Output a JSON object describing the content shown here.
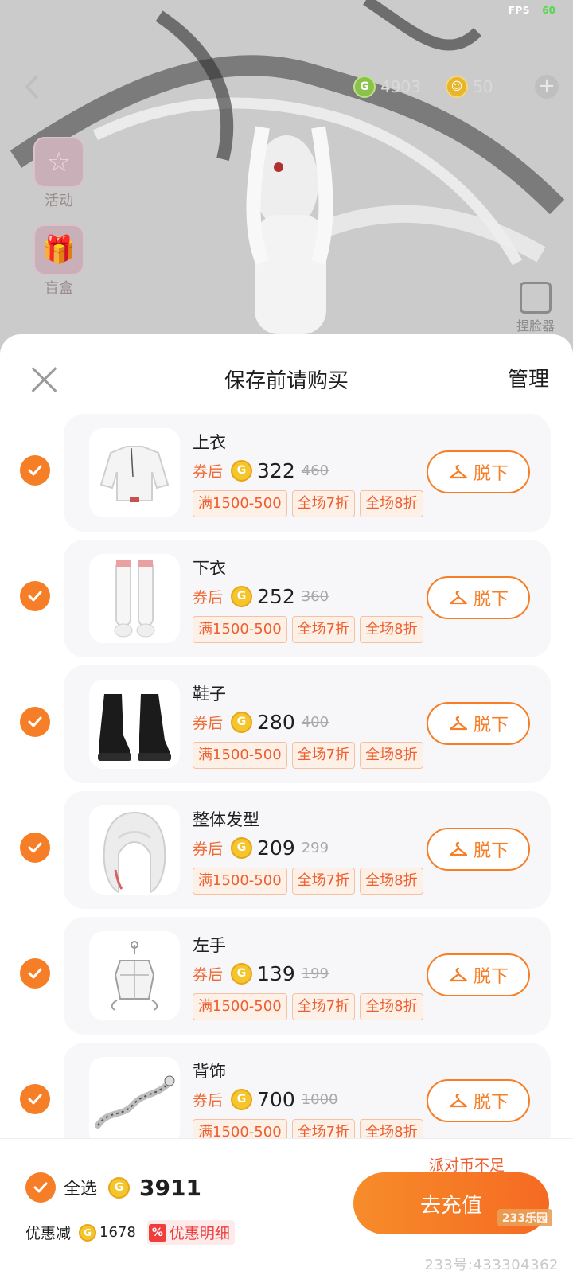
{
  "scene": {
    "fps_label": "FPS",
    "fps_value": "60",
    "coins_g": "4903",
    "coins_y": "50",
    "side_items": [
      {
        "label": "活动",
        "icon": "star-icon"
      },
      {
        "label": "盲盒",
        "icon": "gift-box-icon"
      }
    ],
    "face_edit_label": "捏脸器"
  },
  "sheet": {
    "title": "保存前请购买",
    "manage_label": "管理",
    "items": [
      {
        "name": "上衣",
        "after_label": "券后",
        "price": "322",
        "original": "460",
        "tags": [
          "满1500-500",
          "全场7折",
          "全场8折"
        ],
        "action": "脱下",
        "thumb": "shirt"
      },
      {
        "name": "下衣",
        "after_label": "券后",
        "price": "252",
        "original": "360",
        "tags": [
          "满1500-500",
          "全场7折",
          "全场8折"
        ],
        "action": "脱下",
        "thumb": "stockings"
      },
      {
        "name": "鞋子",
        "after_label": "券后",
        "price": "280",
        "original": "400",
        "tags": [
          "满1500-500",
          "全场7折",
          "全场8折"
        ],
        "action": "脱下",
        "thumb": "boots"
      },
      {
        "name": "整体发型",
        "after_label": "券后",
        "price": "209",
        "original": "299",
        "tags": [
          "满1500-500",
          "全场7折",
          "全场8折"
        ],
        "action": "脱下",
        "thumb": "hair"
      },
      {
        "name": "左手",
        "after_label": "券后",
        "price": "139",
        "original": "199",
        "tags": [
          "满1500-500",
          "全场7折",
          "全场8折"
        ],
        "action": "脱下",
        "thumb": "lantern"
      },
      {
        "name": "背饰",
        "after_label": "券后",
        "price": "700",
        "original": "1000",
        "tags": [
          "满1500-500",
          "全场7折",
          "全场8折"
        ],
        "action": "脱下",
        "thumb": "dragon"
      }
    ]
  },
  "footer": {
    "insufficient": "派对币不足",
    "select_all": "全选",
    "total": "3911",
    "discount_label": "优惠减",
    "discount_value": "1678",
    "discount_detail": "优惠明细",
    "recharge": "去充值",
    "watermark_logo": "233乐园",
    "watermark": "233号:433304362"
  },
  "colors": {
    "accent": "#f57e26",
    "tag_text": "#ef5e2e",
    "discount_red": "#ef3e3e"
  }
}
